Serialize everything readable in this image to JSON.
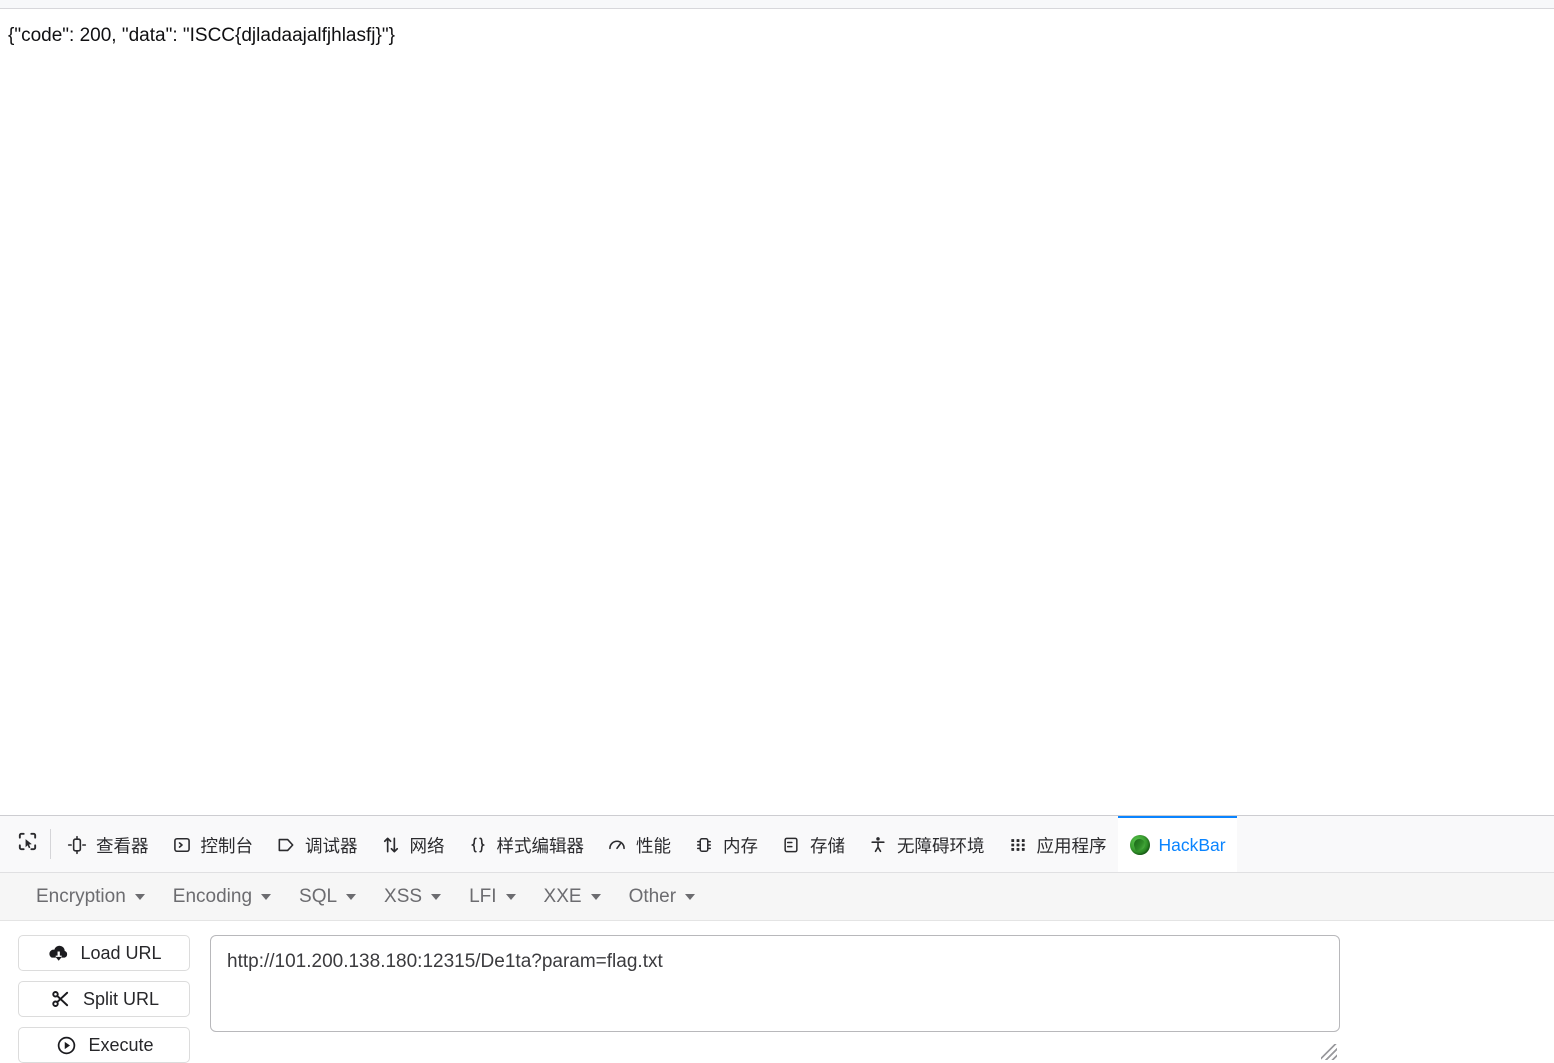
{
  "page": {
    "response_body": "{\"code\": 200, \"data\": \"ISCC{djladaajalfjhlasfj}\"}"
  },
  "devtools": {
    "picker_icon": "element-picker-icon",
    "tabs": [
      {
        "label": "查看器",
        "icon": "inspector-icon",
        "selected": false
      },
      {
        "label": "控制台",
        "icon": "console-icon",
        "selected": false
      },
      {
        "label": "调试器",
        "icon": "debugger-icon",
        "selected": false
      },
      {
        "label": "网络",
        "icon": "network-icon",
        "selected": false
      },
      {
        "label": "样式编辑器",
        "icon": "style-editor-icon",
        "selected": false
      },
      {
        "label": "性能",
        "icon": "performance-icon",
        "selected": false
      },
      {
        "label": "内存",
        "icon": "memory-icon",
        "selected": false
      },
      {
        "label": "存储",
        "icon": "storage-icon",
        "selected": false
      },
      {
        "label": "无障碍环境",
        "icon": "accessibility-icon",
        "selected": false
      },
      {
        "label": "应用程序",
        "icon": "application-icon",
        "selected": false
      },
      {
        "label": "HackBar",
        "icon": "hackbar-icon",
        "selected": true
      }
    ],
    "selected_tab_color": "#0a84ff"
  },
  "hackbar": {
    "menus": [
      {
        "label": "Encryption"
      },
      {
        "label": "Encoding"
      },
      {
        "label": "SQL"
      },
      {
        "label": "XSS"
      },
      {
        "label": "LFI"
      },
      {
        "label": "XXE"
      },
      {
        "label": "Other"
      }
    ],
    "buttons": [
      {
        "label": "Load URL",
        "icon": "cloud-download-icon"
      },
      {
        "label": "Split URL",
        "icon": "scissors-icon"
      },
      {
        "label": "Execute",
        "icon": "play-circle-icon"
      }
    ],
    "url_field": {
      "value": "http://101.200.138.180:12315/De1ta?param=flag.txt",
      "placeholder": "Enter URL here"
    }
  }
}
